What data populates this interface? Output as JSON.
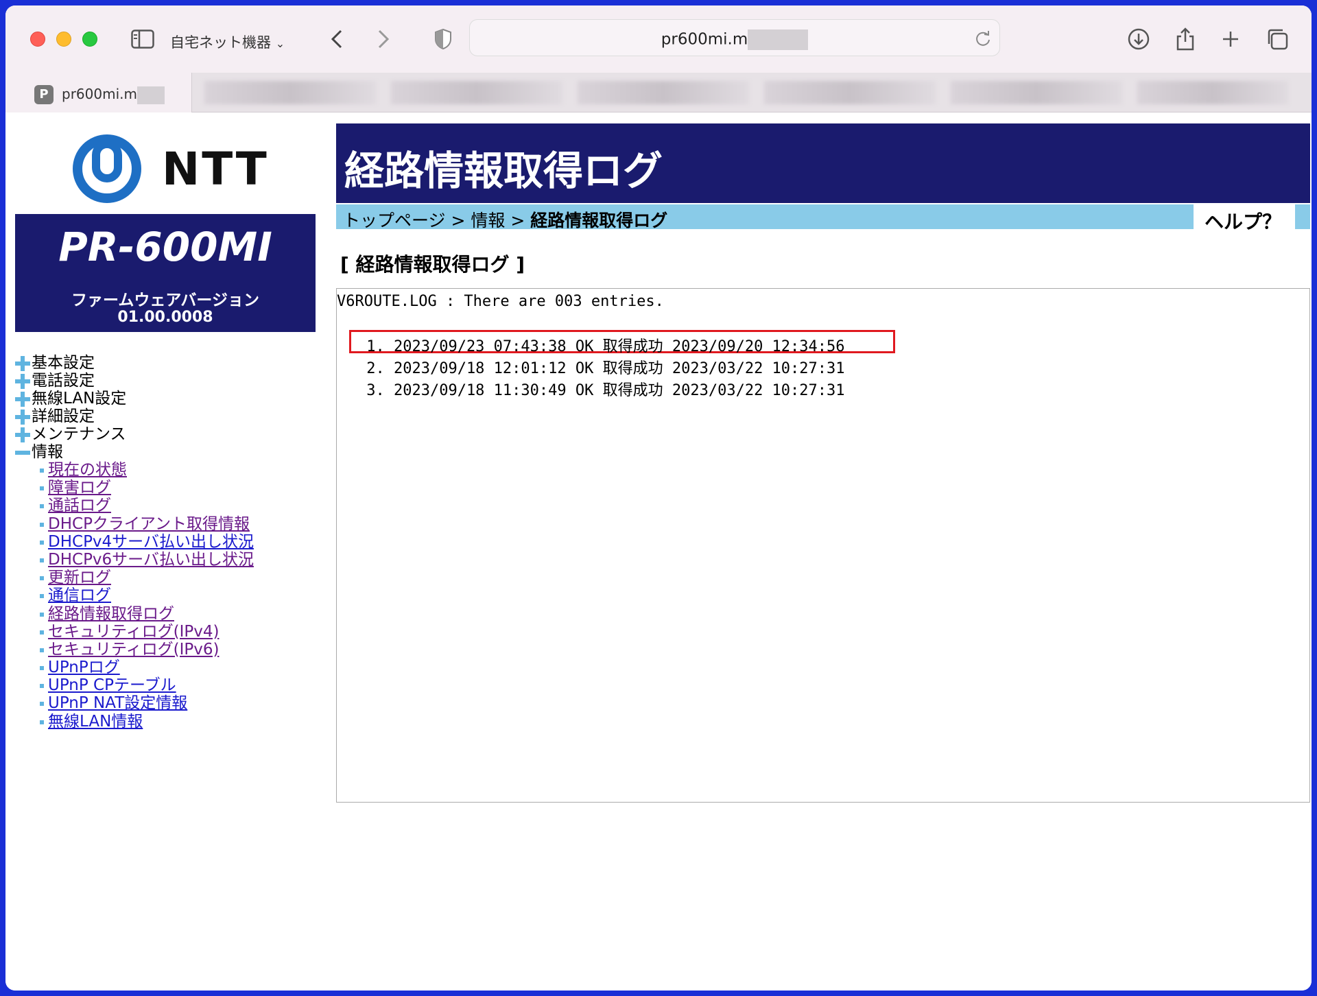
{
  "browser": {
    "profile_label": "自宅ネット機器",
    "url": "pr600mi.m",
    "tab_title": "pr600mi.m",
    "favicon_letter": "P"
  },
  "sidebar": {
    "logo_text": "NTT",
    "model": "PR-600MI",
    "firmware_label": "ファームウェアバージョン",
    "firmware_version": "01.00.0008",
    "menu": [
      {
        "label": "基本設定",
        "state": "collapsed"
      },
      {
        "label": "電話設定",
        "state": "collapsed"
      },
      {
        "label": "無線LAN設定",
        "state": "collapsed"
      },
      {
        "label": "詳細設定",
        "state": "collapsed"
      },
      {
        "label": "メンテナンス",
        "state": "collapsed"
      },
      {
        "label": "情報",
        "state": "expanded"
      }
    ],
    "info_links": [
      {
        "label": "現在の状態",
        "visited": true
      },
      {
        "label": "障害ログ",
        "visited": true
      },
      {
        "label": "通話ログ",
        "visited": true
      },
      {
        "label": "DHCPクライアント取得情報",
        "visited": true
      },
      {
        "label": "DHCPv4サーバ払い出し状況",
        "visited": false
      },
      {
        "label": "DHCPv6サーバ払い出し状況",
        "visited": true
      },
      {
        "label": "更新ログ",
        "visited": true
      },
      {
        "label": "通信ログ",
        "visited": false
      },
      {
        "label": "経路情報取得ログ",
        "visited": true
      },
      {
        "label": "セキュリティログ(IPv4)",
        "visited": true
      },
      {
        "label": "セキュリティログ(IPv6)",
        "visited": true
      },
      {
        "label": "UPnPログ",
        "visited": false
      },
      {
        "label": "UPnP CPテーブル",
        "visited": false
      },
      {
        "label": "UPnP NAT設定情報",
        "visited": false
      },
      {
        "label": "無線LAN情報",
        "visited": false
      }
    ]
  },
  "main": {
    "title": "経路情報取得ログ",
    "breadcrumb": {
      "top": "トップページ",
      "sep": ">",
      "info": "情報",
      "current": "経路情報取得ログ"
    },
    "help": "ヘルプ？",
    "section_title": "[ 経路情報取得ログ ]",
    "log": {
      "header": "V6ROUTE.LOG : There are 003 entries.",
      "entries": [
        " 1. 2023/09/23 07:43:38 OK 取得成功 2023/09/20 12:34:56",
        " 2. 2023/09/18 12:01:12 OK 取得成功 2023/03/22 10:27:31",
        " 3. 2023/09/18 11:30:49 OK 取得成功 2023/03/22 10:27:31"
      ]
    }
  },
  "colors": {
    "header_navy": "#1a1b6e",
    "breadcrumb_blue": "#89cbe8",
    "highlight_red": "#e0191f",
    "link_blue": "#1a1acd",
    "link_visited": "#6a1a8a"
  }
}
